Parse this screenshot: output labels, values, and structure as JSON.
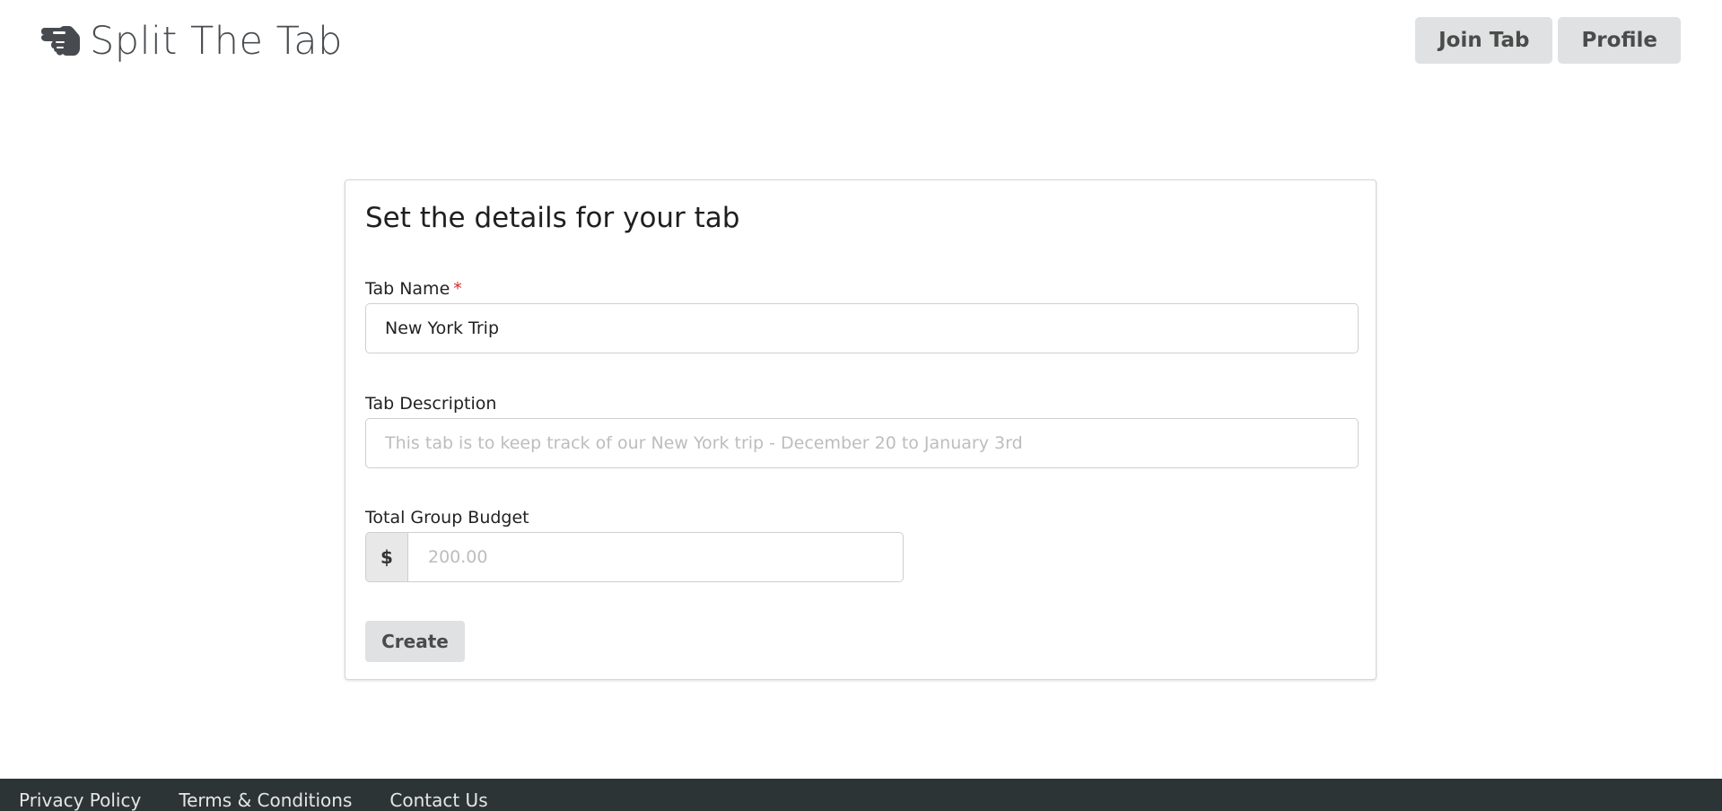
{
  "header": {
    "brand": "Split The Tab",
    "brand_icon": "hand-pointing-icon",
    "nav": {
      "join_tab": "Join Tab",
      "profile": "Profile"
    }
  },
  "form": {
    "title": "Set the details for your tab",
    "tab_name": {
      "label": "Tab Name",
      "required_marker": "*",
      "value": "New York Trip"
    },
    "tab_description": {
      "label": "Tab Description",
      "placeholder": "This tab is to keep track of our New York trip - December 20 to January 3rd",
      "value": ""
    },
    "budget": {
      "label": "Total Group Budget",
      "currency_symbol": "$",
      "placeholder": "200.00",
      "value": ""
    },
    "submit_label": "Create"
  },
  "footer": {
    "links": [
      "Privacy Policy",
      "Terms & Conditions",
      "Contact Us"
    ]
  },
  "colors": {
    "footer_bg": "#2d3436",
    "button_bg": "#e0e1e2",
    "required": "#db2828"
  }
}
